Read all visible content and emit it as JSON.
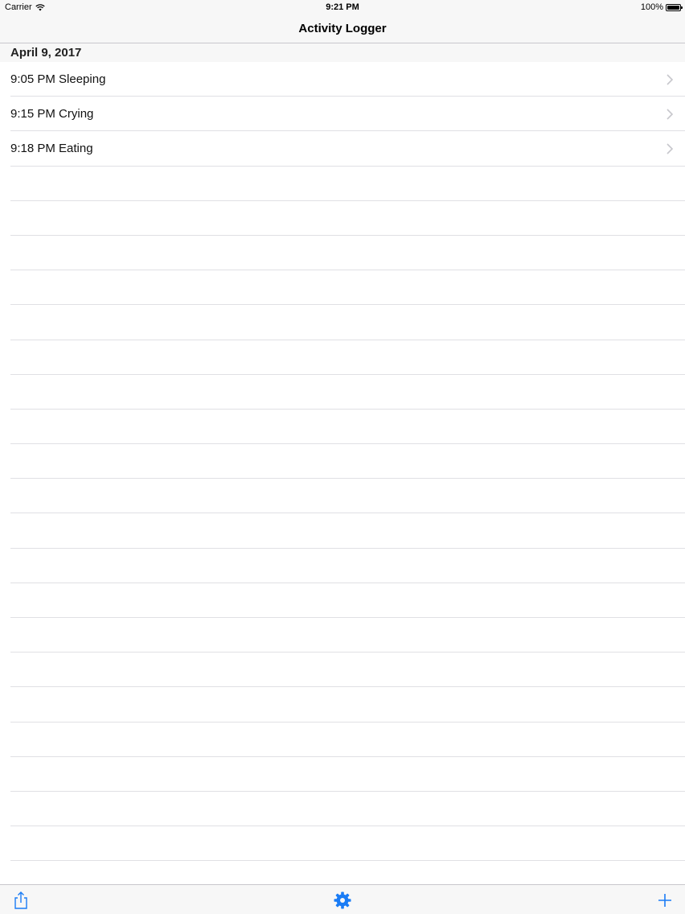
{
  "status_bar": {
    "carrier": "Carrier",
    "time": "9:21 PM",
    "battery": "100%",
    "battery_level": 1.0
  },
  "nav": {
    "title": "Activity Logger"
  },
  "section": {
    "header": "April 9, 2017"
  },
  "entries": [
    {
      "label": "9:05 PM Sleeping"
    },
    {
      "label": "9:15 PM Crying"
    },
    {
      "label": "9:18 PM Eating"
    }
  ],
  "toolbar": {
    "share_icon": "share-icon",
    "settings_icon": "gear-icon",
    "add_icon": "plus-icon"
  },
  "colors": {
    "accent": "#1a7cf5",
    "separator": "#e0e0e4",
    "bar_background": "#f7f7f7",
    "chevron": "#c7c7cc"
  }
}
